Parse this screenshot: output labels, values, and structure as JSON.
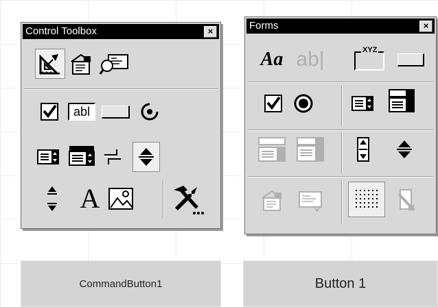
{
  "control_toolbox": {
    "title": "Control Toolbox",
    "close_glyph": "×",
    "tools": {
      "design_mode": "design-mode-icon",
      "properties": "properties-icon",
      "view_code": "view-code-icon",
      "check_box": "checkbox-icon",
      "text_box": "textbox-icon",
      "text_box_label": "abl",
      "command_button": "command-button-icon",
      "option_button": "option-button-icon",
      "list_box": "listbox-icon",
      "combo_box": "combobox-icon",
      "toggle_button": "toggle-button-icon",
      "spin_button": "spin-button-icon",
      "scroll_bar": "scrollbar-icon",
      "label": "label-icon",
      "label_glyph": "A",
      "image": "image-icon",
      "more_controls": "more-controls-icon"
    }
  },
  "forms_toolbar": {
    "title": "Forms",
    "close_glyph": "×",
    "tools": {
      "label_glyph": "Aa",
      "edit_box_glyph": "ab|",
      "group_box_caption": "XYZ"
    }
  },
  "buttons": {
    "command_button_1": "CommandButton1",
    "button_1": "Button 1"
  },
  "colors": {
    "panel_bg": "#d8d8d8",
    "titlebar_bg": "#000000",
    "titlebar_fg": "#ffffff",
    "disabled_icon": "#b0b0b0"
  }
}
